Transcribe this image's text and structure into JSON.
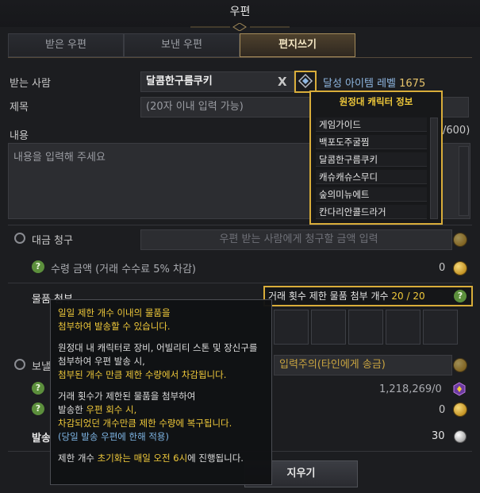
{
  "window": {
    "title": "우편"
  },
  "tabs": [
    {
      "label": "받은 우편"
    },
    {
      "label": "보낸 우편"
    },
    {
      "label": "편지쓰기"
    }
  ],
  "recipient": {
    "label": "받는 사람",
    "value": "달콤한구름쿠키",
    "clear_icon": "X",
    "achievement_label": "달성 아이템 레벨",
    "achievement_value": "1675"
  },
  "subject": {
    "label": "제목",
    "placeholder": "(20자 이내 입력 가능)"
  },
  "content": {
    "label": "내용",
    "placeholder": "내용을 입력해 주세요",
    "counter": "/600)"
  },
  "dropdown": {
    "title": "원정대 캐릭터 정보",
    "items": [
      {
        "name": "게임가이드"
      },
      {
        "name": "백포도주굴찜"
      },
      {
        "name": "달콤한구름쿠키"
      },
      {
        "name": "캐슈캐슈스무디"
      },
      {
        "name": "숲의미뉴에트"
      },
      {
        "name": "칸다리안콜드라거"
      }
    ]
  },
  "payment_request": {
    "label": "대금 청구",
    "placeholder": "우편 받는 사람에게 청구할 금액 입력",
    "receive_label": "수령 금액 (거래 수수료 5% 차감)",
    "receive_value": "0"
  },
  "attachment": {
    "label": "물품 첨부",
    "limit_label": "거래 횟수 제한 물품 첨부 개수",
    "limit_value": "20 / 20"
  },
  "send_money": {
    "label": "보낼",
    "warning": "입력주의(타인에게 송금)",
    "balance": "1,218,269/0",
    "gold_value": "0"
  },
  "shipping": {
    "label": "발송",
    "cost": "30"
  },
  "buttons": {
    "clear": "지우기"
  },
  "tooltip": {
    "line1": "일일 제한 개수 이내의 물품을",
    "line2": "첨부하여 발송할 수 있습니다.",
    "line3": "원정대 내 캐릭터로 장비, 어빌리티 스톤 및 장신구를",
    "line4": "첨부하여 우편 발송 시,",
    "line5": "첨부된 개수 만큼 제한 수량에서 차감됩니다.",
    "line6": "거래 횟수가 제한된 물품을 첨부하여",
    "line7a": "발송한 ",
    "line7b": "우편 회수 시,",
    "line8": "차감되었던 개수만큼 제한 수량에 복구됩니다.",
    "line9": "(당일 발송 우편에 한해 적용)",
    "line10a": "제한 개수 ",
    "line10b": "초기화는 매일 오전 6시",
    "line10c": "에 진행됩니다."
  },
  "colors": {
    "accent_gold": "#d9ad3a",
    "highlight_yellow": "#f0c93a",
    "info_blue": "#7fb6e6"
  }
}
